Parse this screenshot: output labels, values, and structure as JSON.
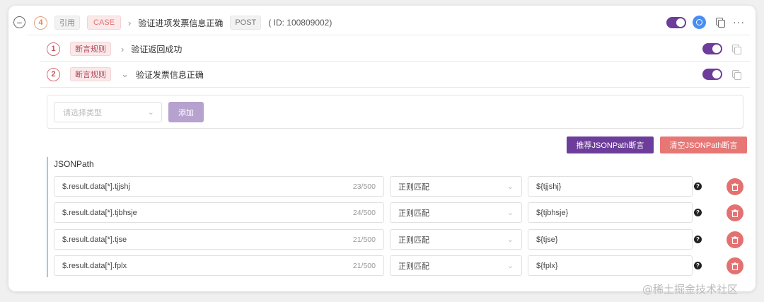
{
  "case": {
    "index": "4",
    "ref_tag": "引用",
    "case_tag": "CASE",
    "title": "验证进项发票信息正确",
    "method": "POST",
    "id_text": "( ID: 100809002)"
  },
  "assertions": [
    {
      "index": "1",
      "tag": "断言规则",
      "title": "验证返回成功",
      "chevron": "›"
    },
    {
      "index": "2",
      "tag": "断言规则",
      "title": "验证发票信息正确",
      "chevron": "⌄"
    }
  ],
  "add_panel": {
    "type_placeholder": "请选择类型",
    "add_label": "添加"
  },
  "actions": {
    "recommend_label": "推荐JSONPath断言",
    "clear_label": "清空JSONPath断言"
  },
  "jsonpath": {
    "label": "JSONPath",
    "rows": [
      {
        "path": "$.result.data[*].tjjshj",
        "count": "23/500",
        "match": "正则匹配",
        "var": "${tjjshj}"
      },
      {
        "path": "$.result.data[*].tjbhsje",
        "count": "24/500",
        "match": "正则匹配",
        "var": "${tjbhsje}"
      },
      {
        "path": "$.result.data[*].tjse",
        "count": "21/500",
        "match": "正则匹配",
        "var": "${tjse}"
      },
      {
        "path": "$.result.data[*].fplx",
        "count": "21/500",
        "match": "正则匹配",
        "var": "${fplx}"
      }
    ]
  },
  "watermark": "@稀土掘金技术社区",
  "colors": {
    "accent_purple": "#6c3d9a",
    "danger_red": "#e67775",
    "info_blue": "#4a8ef0"
  }
}
